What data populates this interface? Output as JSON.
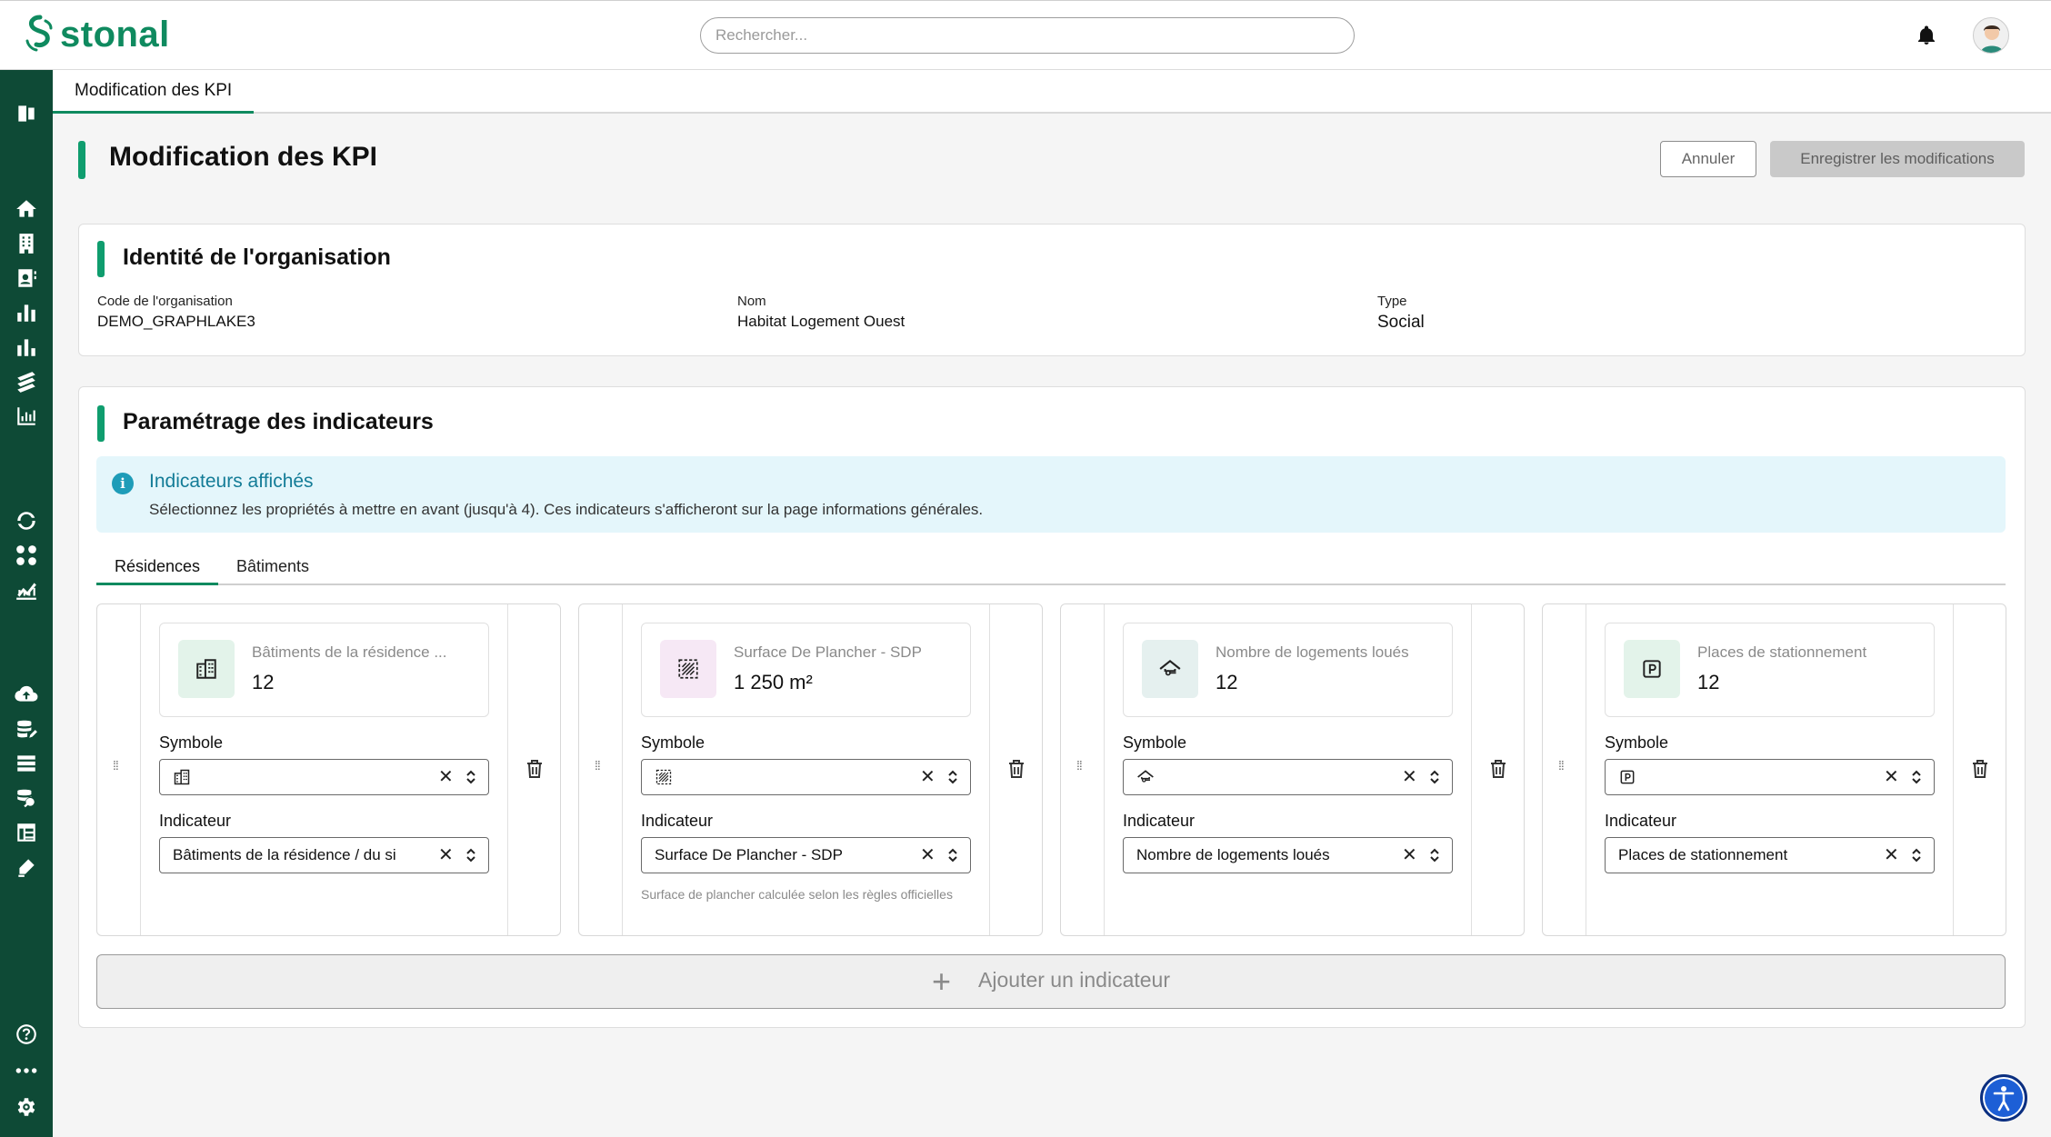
{
  "brand": {
    "name": "stonal",
    "color": "#0f8a5f"
  },
  "search": {
    "placeholder": "Rechercher..."
  },
  "page_tab": {
    "label": "Modification des KPI"
  },
  "header": {
    "title": "Modification des KPI",
    "cancel_label": "Annuler",
    "save_label": "Enregistrer les modifications"
  },
  "identity": {
    "title": "Identité de l'organisation",
    "fields": [
      {
        "label": "Code de l'organisation",
        "value": "DEMO_GRAPHLAKE3"
      },
      {
        "label": "Nom",
        "value": "Habitat Logement Ouest"
      },
      {
        "label": "Type",
        "value": "Social"
      }
    ]
  },
  "params": {
    "title": "Paramétrage des indicateurs",
    "info_title": "Indicateurs affichés",
    "info_text": "Sélectionnez les propriétés à mettre en avant (jusqu'à 4). Ces indicateurs s'afficheront sur la page informations générales.",
    "tabs": [
      "Résidences",
      "Bâtiments"
    ],
    "active_tab": "Résidences",
    "symbol_label": "Symbole",
    "indicator_label": "Indicateur",
    "add_label": "Ajouter un indicateur"
  },
  "kpis": [
    {
      "preview_label": "Bâtiments de la résidence ...",
      "preview_value": "12",
      "icon": "building-icon",
      "tile_color": "#e3f3ea",
      "indicator": "Bâtiments de la résidence / du si",
      "helper": ""
    },
    {
      "preview_label": "Surface De Plancher - SDP",
      "preview_value": "1 250 m²",
      "icon": "hatched-area-icon",
      "tile_color": "#f6e8f5",
      "indicator": "Surface De Plancher - SDP",
      "helper": "Surface de plancher calculée selon les règles officielles"
    },
    {
      "preview_label": "Nombre de logements loués",
      "preview_value": "12",
      "icon": "house-key-icon",
      "tile_color": "#e5f0ef",
      "indicator": "Nombre de logements loués",
      "helper": ""
    },
    {
      "preview_label": "Places de stationnement",
      "preview_value": "12",
      "icon": "parking-icon",
      "tile_color": "#e3f3ea",
      "indicator": "Places de stationnement",
      "helper": ""
    }
  ]
}
